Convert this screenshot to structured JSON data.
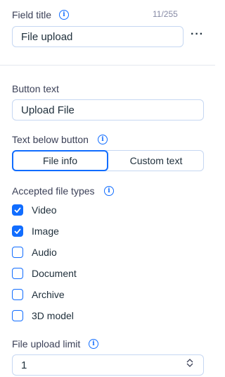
{
  "field_title": {
    "label": "Field title",
    "counter": "11/255",
    "value": "File upload",
    "more_label": "···"
  },
  "button_text": {
    "label": "Button text",
    "value": "Upload File"
  },
  "text_below_button": {
    "label": "Text below button",
    "options": [
      "File info",
      "Custom text"
    ],
    "selected": "File info"
  },
  "accepted_file_types": {
    "label": "Accepted file types",
    "items": [
      {
        "label": "Video",
        "checked": true
      },
      {
        "label": "Image",
        "checked": true
      },
      {
        "label": "Audio",
        "checked": false
      },
      {
        "label": "Document",
        "checked": false
      },
      {
        "label": "Archive",
        "checked": false
      },
      {
        "label": "3D model",
        "checked": false
      }
    ]
  },
  "file_upload_limit": {
    "label": "File upload limit",
    "value": "1"
  },
  "colors": {
    "accent": "#116dff",
    "border": "#c6d7f2",
    "text": "#20303c"
  },
  "icons": {
    "info": "info-icon",
    "check": "checkmark-icon",
    "stepper_up": "chevron-up-icon",
    "stepper_down": "chevron-down-icon"
  }
}
